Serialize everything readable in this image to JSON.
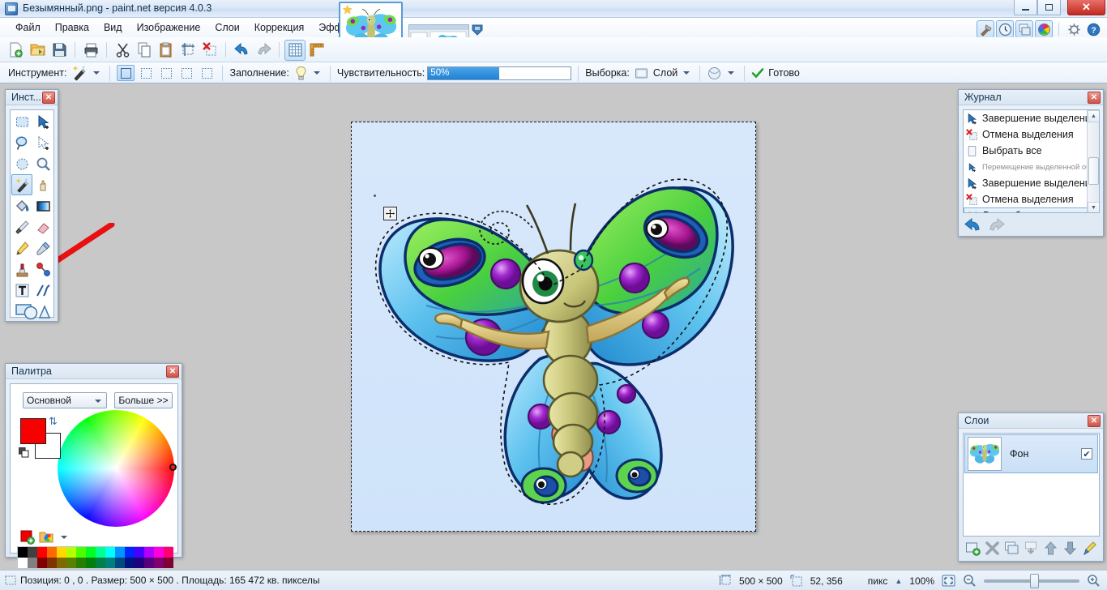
{
  "window": {
    "title": "Безымянный.png - paint.net версия 4.0.3",
    "minimize_label": "",
    "maximize_label": "",
    "close_label": "✕"
  },
  "menu": {
    "items": [
      {
        "label": "Файл",
        "name": "menu-file"
      },
      {
        "label": "Правка",
        "name": "menu-edit"
      },
      {
        "label": "Вид",
        "name": "menu-view"
      },
      {
        "label": "Изображение",
        "name": "menu-image"
      },
      {
        "label": "Слои",
        "name": "menu-layers"
      },
      {
        "label": "Коррекция",
        "name": "menu-adjustments"
      },
      {
        "label": "Эффекты",
        "name": "menu-effects"
      }
    ]
  },
  "toolbar": {
    "buttons": [
      {
        "name": "new-button",
        "icon": "new-file-icon"
      },
      {
        "name": "open-button",
        "icon": "open-folder-icon"
      },
      {
        "name": "save-button",
        "icon": "save-disk-icon"
      },
      {
        "name": "print-button",
        "icon": "printer-icon"
      },
      {
        "name": "cut-button",
        "icon": "scissors-icon"
      },
      {
        "name": "copy-button",
        "icon": "copy-icon"
      },
      {
        "name": "paste-button",
        "icon": "paste-icon"
      },
      {
        "name": "crop-button",
        "icon": "crop-icon"
      },
      {
        "name": "deselect-button",
        "icon": "deselect-icon"
      },
      {
        "name": "undo-button",
        "icon": "undo-arrow-icon"
      },
      {
        "name": "redo-button",
        "icon": "redo-arrow-icon"
      },
      {
        "name": "grid-button",
        "icon": "grid-icon"
      },
      {
        "name": "rulers-button",
        "icon": "ruler-icon"
      }
    ]
  },
  "tool_options": {
    "tool_label": "Инструмент:",
    "tool_icon": "magic-wand-icon",
    "selection_modes": [
      {
        "name": "selection-mode-replace",
        "icon": "square-solid-icon",
        "active": true
      },
      {
        "name": "selection-mode-union",
        "icon": "square-union-icon",
        "active": false
      },
      {
        "name": "selection-mode-exclude",
        "icon": "square-exclude-icon",
        "active": false
      },
      {
        "name": "selection-mode-xor",
        "icon": "square-xor-icon",
        "active": false
      },
      {
        "name": "selection-mode-intersect",
        "icon": "square-intersect-icon",
        "active": false
      }
    ],
    "fill_label": "Заполнение:",
    "fill_icon": "bulb-icon",
    "tolerance_label": "Чувствительность:",
    "tolerance_value": "50%",
    "tolerance_percent": 50,
    "sampling_label": "Выборка:",
    "sampling_value": "Слой",
    "sampling_icon": "layer-icon",
    "antialias_icon": "antialias-circle-icon",
    "finish_label": "Готово",
    "finish_icon": "check-mark-icon"
  },
  "header_icons": [
    {
      "name": "tools-panel-toggle",
      "icon": "hammer-icon",
      "active": true
    },
    {
      "name": "history-panel-toggle",
      "icon": "clock-icon",
      "active": true
    },
    {
      "name": "layers-panel-toggle",
      "icon": "layers-stack-icon",
      "active": true
    },
    {
      "name": "palette-panel-toggle",
      "icon": "color-wheel-icon",
      "active": true
    },
    {
      "name": "settings-button",
      "icon": "gear-icon",
      "active": false
    },
    {
      "name": "help-button",
      "icon": "question-help-icon",
      "active": false
    }
  ],
  "tools_panel": {
    "title": "Инст...",
    "close_label": "✕",
    "tools": [
      {
        "name": "tool-rectangle-select",
        "icon": "rectangle-select-icon",
        "active": false
      },
      {
        "name": "tool-move-selected",
        "icon": "move-selected-icon",
        "active": false
      },
      {
        "name": "tool-lasso-select",
        "icon": "lasso-select-icon",
        "active": false
      },
      {
        "name": "tool-move-selection",
        "icon": "move-selection-icon",
        "active": false
      },
      {
        "name": "tool-ellipse-select",
        "icon": "ellipse-select-icon",
        "active": false
      },
      {
        "name": "tool-zoom",
        "icon": "magnifier-icon",
        "active": false
      },
      {
        "name": "tool-magic-wand",
        "icon": "magic-wand-icon",
        "active": true
      },
      {
        "name": "tool-pan",
        "icon": "pan-hand-icon",
        "active": false
      },
      {
        "name": "tool-paint-bucket",
        "icon": "paint-bucket-icon",
        "active": false
      },
      {
        "name": "tool-gradient",
        "icon": "gradient-icon",
        "active": false
      },
      {
        "name": "tool-paintbrush",
        "icon": "paintbrush-icon",
        "active": false
      },
      {
        "name": "tool-eraser",
        "icon": "eraser-icon",
        "active": false
      },
      {
        "name": "tool-pencil",
        "icon": "pencil-icon",
        "active": false
      },
      {
        "name": "tool-color-picker",
        "icon": "eyedropper-icon",
        "active": false
      },
      {
        "name": "tool-clone-stamp",
        "icon": "clone-stamp-icon",
        "active": false
      },
      {
        "name": "tool-recolor",
        "icon": "recolor-icon",
        "active": false
      },
      {
        "name": "tool-text",
        "icon": "text-t-icon",
        "active": false
      },
      {
        "name": "tool-line-curve",
        "icon": "line-curve-icon",
        "active": false
      },
      {
        "name": "tool-shapes",
        "icon": "shapes-icon",
        "active": false
      }
    ]
  },
  "palette_panel": {
    "title": "Палитра",
    "close_label": "✕",
    "mode_value": "Основной",
    "more_label": "Больше >>",
    "primary_color": "#f80000",
    "secondary_color": "#ffffff",
    "swap_icon": "swap-colors-icon",
    "reset_icon": "reset-colors-icon",
    "add_color_icon": "add-color-icon",
    "open-palette_icon": "open-palette-icon",
    "swatches_row1": [
      "#000000",
      "#404040",
      "#ff0000",
      "#ff6a00",
      "#ffd800",
      "#b6ff00",
      "#4cff00",
      "#00ff21",
      "#00ff90",
      "#00ffff",
      "#0094ff",
      "#0026ff",
      "#4800ff",
      "#b200ff",
      "#ff00dc",
      "#ff006e"
    ],
    "swatches_row2": [
      "#ffffff",
      "#808080",
      "#7f0000",
      "#7f3300",
      "#7f6a00",
      "#5b7f00",
      "#267f00",
      "#007f0e",
      "#007f46",
      "#007f7f",
      "#004a7f",
      "#00137f",
      "#21007f",
      "#57007f",
      "#7f006e",
      "#7f0037"
    ]
  },
  "history_panel": {
    "title": "Журнал",
    "close_label": "✕",
    "entries": [
      {
        "label": "Завершение выделения",
        "icon": "move-selected-icon",
        "current": false,
        "dim": false
      },
      {
        "label": "Отмена выделения",
        "icon": "deselect-icon",
        "current": false,
        "dim": false
      },
      {
        "label": "Выбрать все",
        "icon": "select-all-icon",
        "current": false,
        "dim": false
      },
      {
        "label": "Перемещение выделенной области",
        "icon": "move-selection-icon",
        "current": false,
        "dim": true
      },
      {
        "label": "Завершение выделения",
        "icon": "move-selected-icon",
        "current": false,
        "dim": false
      },
      {
        "label": "Отмена выделения",
        "icon": "deselect-icon",
        "current": false,
        "dim": false
      },
      {
        "label": "Волшебная палочка",
        "icon": "magic-wand-icon",
        "current": true,
        "dim": false
      }
    ],
    "undo_icon": "undo-arrow-icon",
    "redo_icon": "redo-arrow-icon"
  },
  "layers_panel": {
    "title": "Слои",
    "close_label": "✕",
    "layers": [
      {
        "name": "Фон",
        "visible": true,
        "checked_glyph": "✔",
        "selected": true
      }
    ],
    "buttons": [
      {
        "name": "add-layer-button",
        "icon": "add-layer-icon"
      },
      {
        "name": "delete-layer-button",
        "icon": "delete-layer-icon"
      },
      {
        "name": "duplicate-layer-button",
        "icon": "duplicate-layer-icon"
      },
      {
        "name": "merge-layer-down-button",
        "icon": "merge-down-icon"
      },
      {
        "name": "move-layer-up-button",
        "icon": "arrow-up-icon"
      },
      {
        "name": "move-layer-down-button",
        "icon": "arrow-down-icon"
      },
      {
        "name": "layer-properties-button",
        "icon": "layer-properties-icon"
      }
    ]
  },
  "document_tabs": {
    "active_thumbnail_name": "document-thumbnail-butterfly",
    "star_glyph": "★",
    "preview_name": "document-preview-popup",
    "arrow_name": "tab-dropdown-arrow"
  },
  "statusbar": {
    "cursor_icon": "selection-icon",
    "position_text": "Позиция: 0 , 0 . Размер: 500  × 500 . Площадь: 165 472 кв. пикселы",
    "image_size_icon": "image-size-icon",
    "image_size": "500 × 500",
    "selection_icon": "selection-size-icon",
    "selection_size": "52, 356",
    "units_label": "пикс",
    "units_caret": "▲",
    "zoom_value": "100%",
    "fit_icon": "fit-to-window-icon",
    "zoom_out_icon": "zoom-out-icon",
    "zoom_in_icon": "zoom-in-icon",
    "zoom_percent": 50
  },
  "canvas": {
    "name": "image-canvas",
    "background_color": "#d4e6fb",
    "content": "butterfly-illustration",
    "move_cursor_icon": "move-cursor-icon",
    "annotation_arrow": "red-annotation-arrow"
  }
}
